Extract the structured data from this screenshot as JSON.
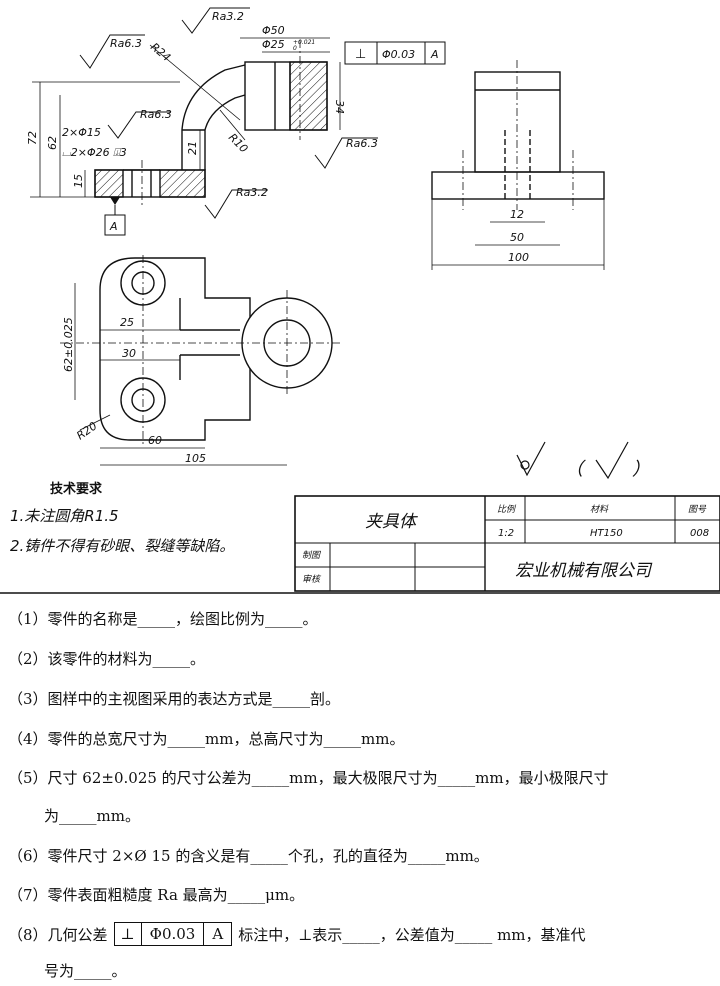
{
  "drawing": {
    "dims": {
      "phi50": "Φ50",
      "phi25": "Φ25",
      "phi25_tol": "+0.021",
      "phi25_tol_low": "0",
      "d72": "72",
      "d62": "62",
      "d34": "34",
      "d21": "21",
      "d15": "15",
      "r24": "R24",
      "r10": "R10",
      "holes": "2×Φ15",
      "cbore": "⌴2×Φ26 ⍗3",
      "d12": "12",
      "d50": "50",
      "d100": "100",
      "d62tol": "62±0.025",
      "d25": "25",
      "d30": "30",
      "r20": "R20",
      "d60": "60",
      "d105": "105"
    },
    "roughness": {
      "ra63": "Ra6.3",
      "ra32": "Ra3.2"
    },
    "gdt": {
      "symbol": "⊥",
      "value": "Φ0.03",
      "datum": "A"
    },
    "datum_label": "A",
    "other_surfaces": "（",
    "other_surfaces_close": "）"
  },
  "tech_requirements": {
    "title": "技术要求",
    "item1": "1.未注圆角R1.5",
    "item2": "2.铸件不得有砂眼、裂缝等缺陷。"
  },
  "title_block": {
    "part_name": "夹具体",
    "scale_header": "比例",
    "material_header": "材料",
    "drawing_no_header": "图号",
    "scale": "1:2",
    "material": "HT150",
    "drawing_no": "008",
    "drawn_by": "制图",
    "checked_by": "审核",
    "company": "宏业机械有限公司"
  },
  "questions": {
    "q1": "（1）零件的名称是_____，绘图比例为_____。",
    "q2": "（2）该零件的材料为_____。",
    "q3": "（3）图样中的主视图采用的表达方式是_____剖。",
    "q4": "（4）零件的总宽尺寸为_____mm，总高尺寸为_____mm。",
    "q5a": "（5）尺寸 62±0.025 的尺寸公差为_____mm，最大极限尺寸为_____mm，最小极限尺寸",
    "q5b": "为_____mm。",
    "q6": "（6）零件尺寸 2×Ø 15 的含义是有_____个孔，孔的直径为_____mm。",
    "q7": "（7）零件表面粗糙度 Ra 最高为_____μm。",
    "q8a_pre": "（8）几何公差",
    "q8_sym": "⊥",
    "q8_val": "Φ0.03",
    "q8_datum": "A",
    "q8a_post": "标注中，⊥表示_____，公差值为_____ mm，基准代",
    "q8b": "号为_____。"
  }
}
